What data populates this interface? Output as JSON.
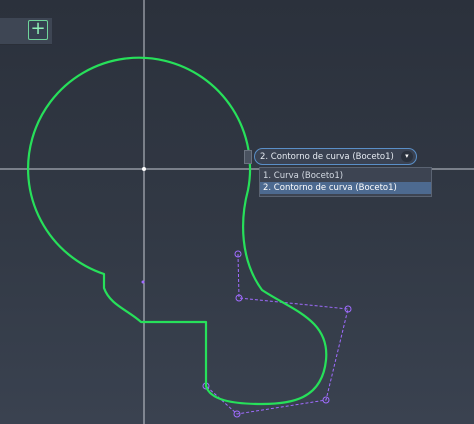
{
  "toolbar": {
    "add_button_symbol": "+",
    "add_button_icon": "plus-icon"
  },
  "selector": {
    "current": "2. Contorno de curva (Boceto1)",
    "arrow_symbol": "▾",
    "options": [
      {
        "label": "1. Curva (Boceto1)",
        "selected": false
      },
      {
        "label": "2. Contorno de curva (Boceto1)",
        "selected": true
      }
    ]
  },
  "colors": {
    "background": "#2f3541",
    "curve": "#27e05a",
    "axis": "#dfe3ea",
    "control_polygon": "#a06cff",
    "selection": "#4d6a90"
  }
}
